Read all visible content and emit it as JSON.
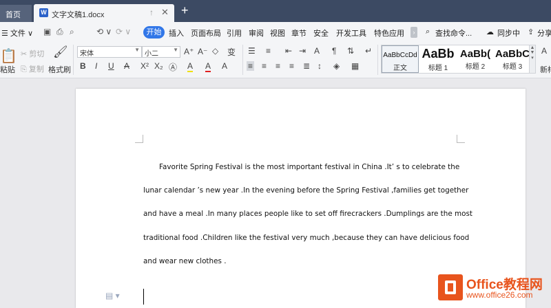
{
  "tabs": {
    "home": "首页",
    "document": "文字文稿1.docx",
    "doc_icon": "W",
    "pin_icon": "↑",
    "close_icon": "✕",
    "add_icon": "+"
  },
  "menu": {
    "file": "☰ 文件 ∨",
    "quick": [
      "▣",
      "⎙",
      "⌕",
      "⟲ ∨",
      "⟳ ∨"
    ],
    "start": "开始",
    "items": [
      "插入",
      "页面布局",
      "引用",
      "审阅",
      "视图",
      "章节",
      "安全",
      "开发工具",
      "特色应用"
    ],
    "more": "›",
    "search": "查找命令...",
    "sync": "同步中",
    "share": "分享"
  },
  "ribbon": {
    "paste": "粘贴",
    "cut": "剪切",
    "copy": "复制",
    "format_painter": "格式刷",
    "font_name": "宋体",
    "font_size": "小二",
    "bold": "B",
    "italic": "I",
    "underline": "U",
    "strike": "A",
    "superscript": "X²",
    "subscript": "X₂",
    "font_color": "A",
    "highlight": "A",
    "grow": "A⁺",
    "shrink": "A⁻",
    "clear": "◇",
    "phonetic": "变",
    "styles": [
      {
        "preview": "AaBbCcDd",
        "name": "正文"
      },
      {
        "preview": "AaBb",
        "name": "标题 1"
      },
      {
        "preview": "AaBb(",
        "name": "标题 2"
      },
      {
        "preview": "AaBbC",
        "name": "标题 3"
      }
    ],
    "new_style": "新样"
  },
  "document": {
    "lines": [
      "Favorite Spring Festival is the most important festival in China .It’  s to celebrate the",
      "lunar calendar    ’s new year .In the evening before the Spring Festival ,families get together",
      "and have a meal .In many places people like to set off firecrackers .Dumplings are the most",
      "traditional food .Children like the festival very much ,because they can have delicious food",
      "and wear new clothes ."
    ]
  },
  "watermark": {
    "brand": "Office教程网",
    "url": "www.office26.com"
  }
}
